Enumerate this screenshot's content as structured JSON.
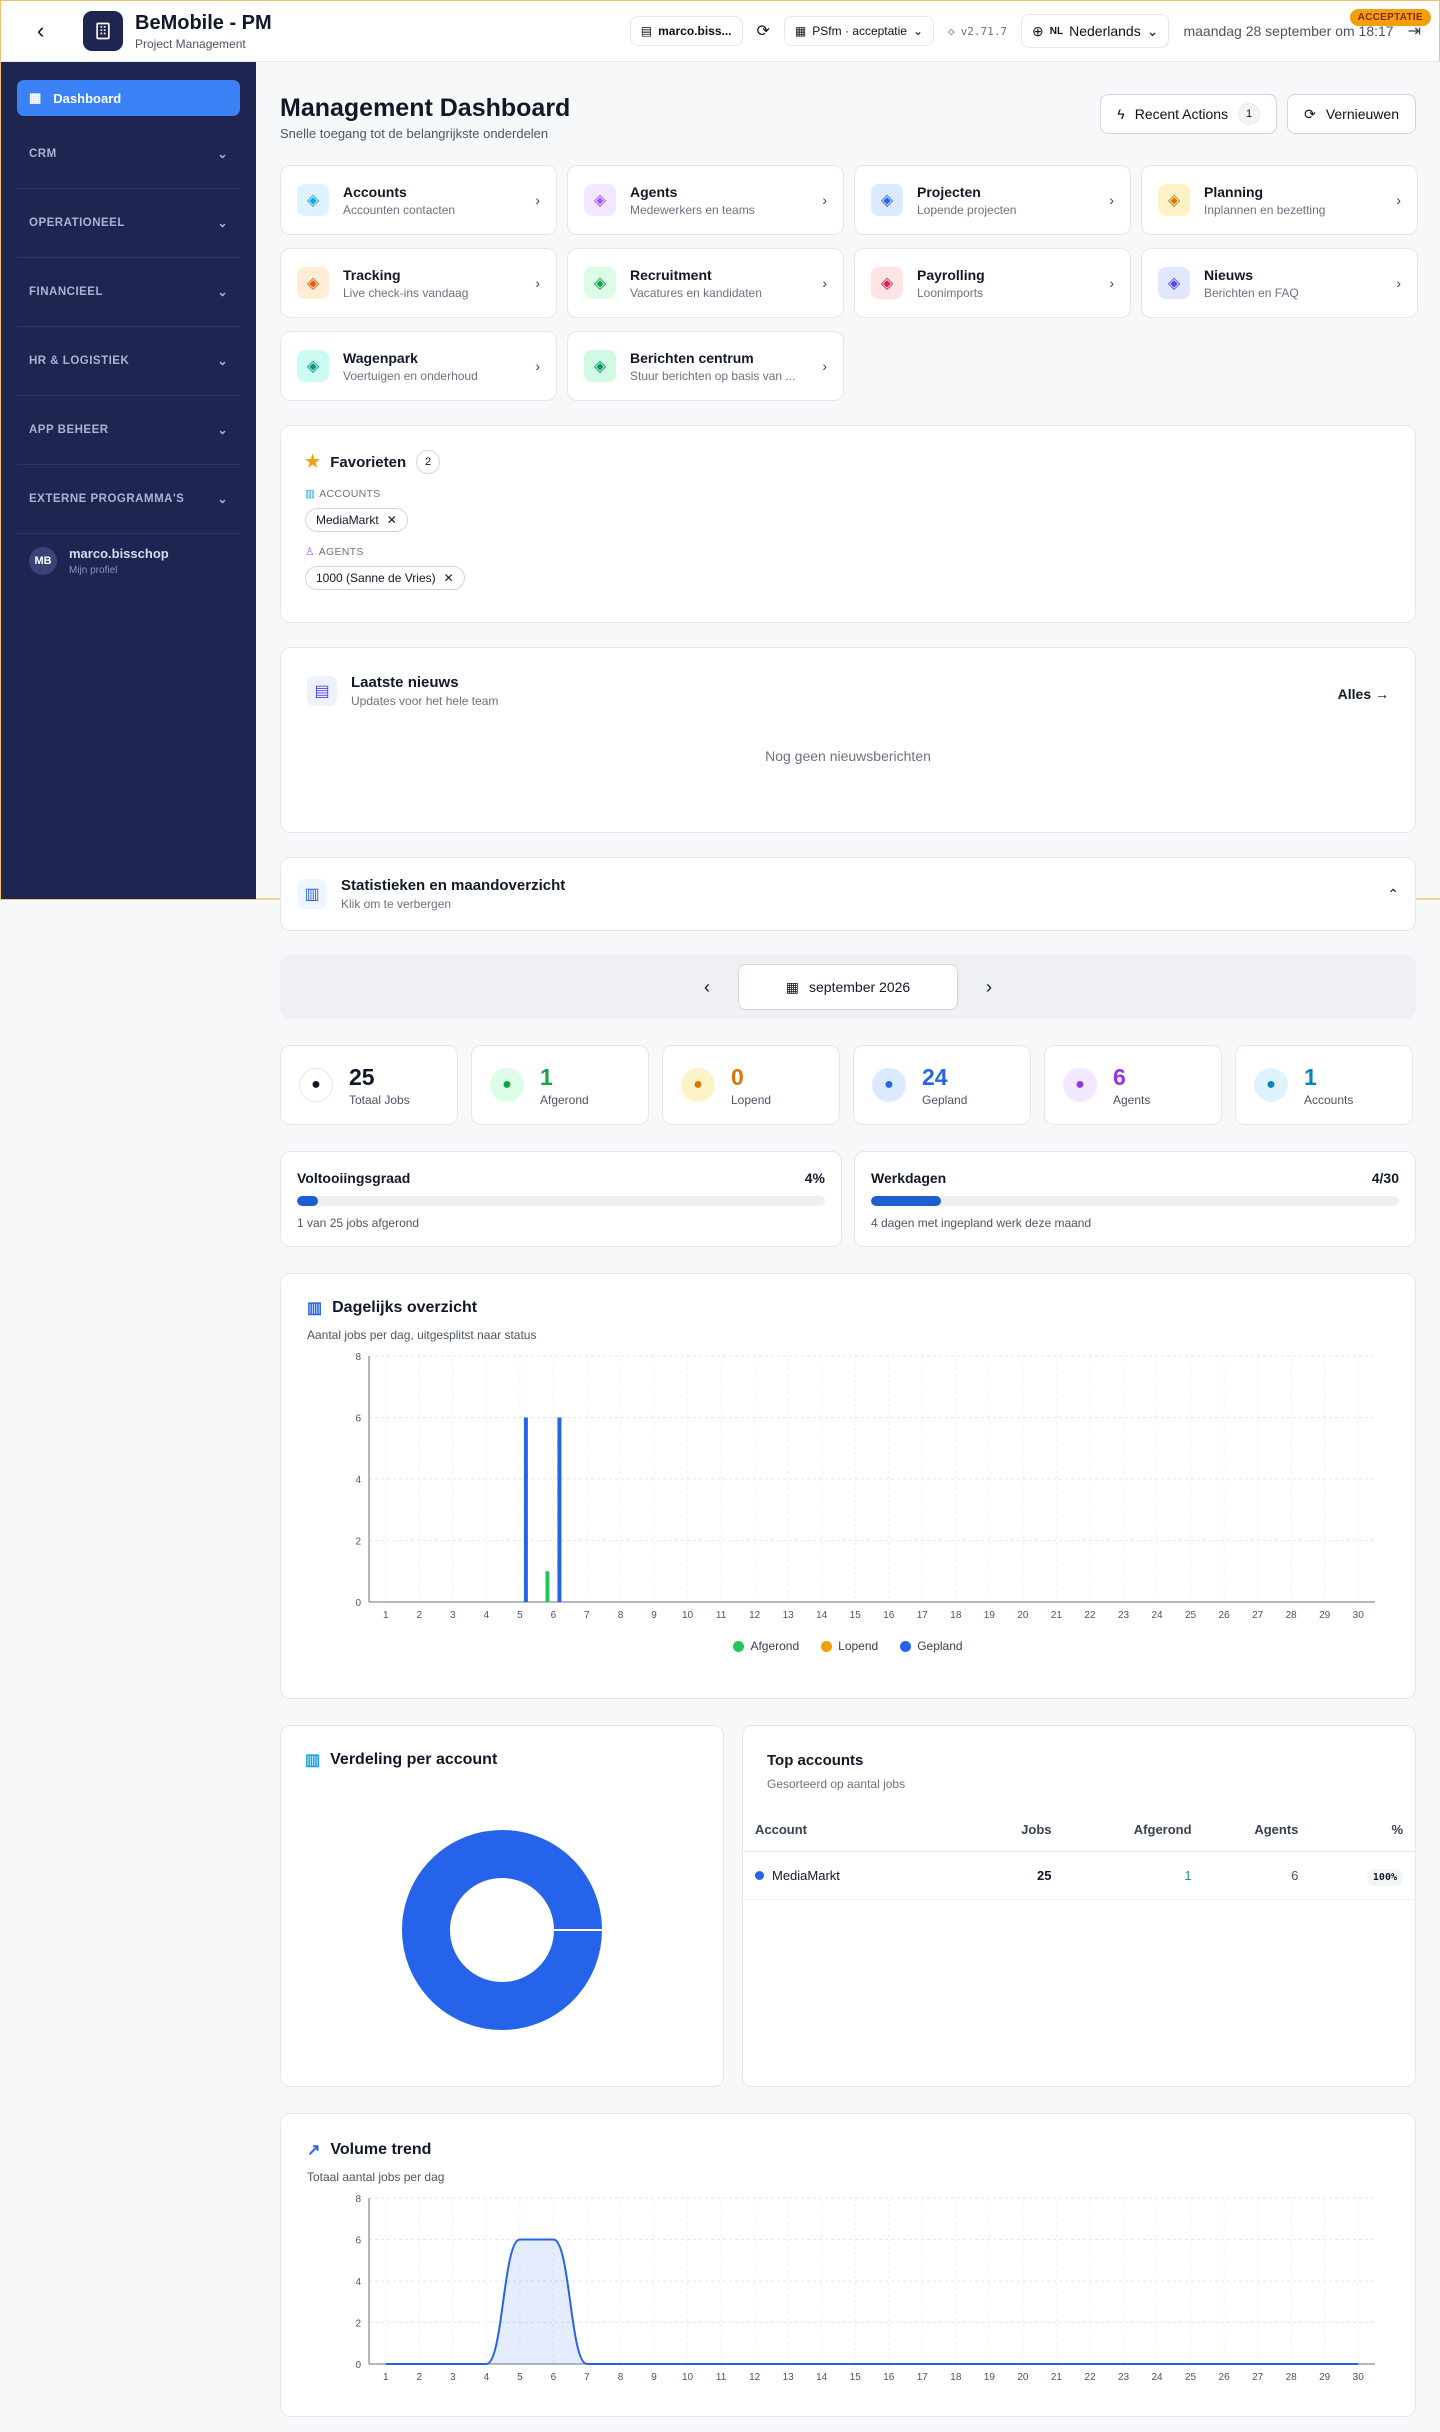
{
  "header": {
    "back": "‹",
    "title": "BeMobile - PM",
    "subtitle": "Project Management",
    "server": "marco.biss...",
    "environment": "PSfm · acceptatie",
    "version": "v2.71.7",
    "language_code": "NL",
    "language": "Nederlands",
    "datetime": "maandag 28 september om 18:17",
    "env_badge": "ACCEPTATIE"
  },
  "sidebar": {
    "dashboard": "Dashboard",
    "sections": [
      "CRM",
      "OPERATIONEEL",
      "FINANCIEEL",
      "HR & LOGISTIEK",
      "APP BEHEER",
      "EXTERNE PROGRAMMA'S"
    ],
    "profile": {
      "initials": "MB",
      "name": "marco.bisschop",
      "sub": "Mijn profiel"
    }
  },
  "page": {
    "title": "Management Dashboard",
    "subtitle": "Snelle toegang tot de belangrijkste onderdelen",
    "recent_actions": "Recent Actions",
    "recent_count": "1",
    "refresh": "Vernieuwen"
  },
  "tiles": [
    {
      "title": "Accounts",
      "sub": "Accounten contacten",
      "color": "#0ea5e9",
      "bg": "#e0f2fe",
      "icon": "building-icon"
    },
    {
      "title": "Agents",
      "sub": "Medewerkers en teams",
      "color": "#a855f7",
      "bg": "#f3e8ff",
      "icon": "users-icon"
    },
    {
      "title": "Projecten",
      "sub": "Lopende projecten",
      "color": "#2563eb",
      "bg": "#dbeafe",
      "icon": "folder-icon"
    },
    {
      "title": "Planning",
      "sub": "Inplannen en bezetting",
      "color": "#d97706",
      "bg": "#fef3c7",
      "icon": "calendar-icon"
    },
    {
      "title": "Tracking",
      "sub": "Live check-ins vandaag",
      "color": "#ea580c",
      "bg": "#ffedd5",
      "icon": "eye-icon"
    },
    {
      "title": "Recruitment",
      "sub": "Vacatures en kandidaten",
      "color": "#16a34a",
      "bg": "#dcfce7",
      "icon": "user-plus-icon"
    },
    {
      "title": "Payrolling",
      "sub": "Loonimports",
      "color": "#e11d48",
      "bg": "#ffe4e6",
      "icon": "document-icon"
    },
    {
      "title": "Nieuws",
      "sub": "Berichten en FAQ",
      "color": "#4f46e5",
      "bg": "#e0e7ff",
      "icon": "megaphone-icon"
    },
    {
      "title": "Wagenpark",
      "sub": "Voertuigen en onderhoud",
      "color": "#0d9488",
      "bg": "#ccfbf1",
      "icon": "car-icon"
    },
    {
      "title": "Berichten centrum",
      "sub": "Stuur berichten op basis van ...",
      "color": "#059669",
      "bg": "#d1fae5",
      "icon": "message-icon"
    }
  ],
  "favorites": {
    "title": "Favorieten",
    "count": "2",
    "groups": [
      {
        "label": "ACCOUNTS",
        "items": [
          "MediaMarkt"
        ]
      },
      {
        "label": "AGENTS",
        "items": [
          "1000 (Sanne de Vries)"
        ]
      }
    ]
  },
  "news": {
    "title": "Laatste nieuws",
    "sub": "Updates voor het hele team",
    "all": "Alles →",
    "empty": "Nog geen nieuwsberichten"
  },
  "stats": {
    "title": "Statistieken en maandoverzicht",
    "sub": "Klik om te verbergen",
    "month": "september 2026"
  },
  "kpis": [
    {
      "value": "25",
      "label": "Totaal Jobs",
      "color": "#111827",
      "bg": "#fff",
      "icon": "briefcase-icon"
    },
    {
      "value": "1",
      "label": "Afgerond",
      "color": "#16a34a",
      "bg": "#dcfce7",
      "icon": "check-circle-icon"
    },
    {
      "value": "0",
      "label": "Lopend",
      "color": "#d97706",
      "bg": "#fef3c7",
      "icon": "clock-icon"
    },
    {
      "value": "24",
      "label": "Gepland",
      "color": "#2563eb",
      "bg": "#dbeafe",
      "icon": "calendar-icon"
    },
    {
      "value": "6",
      "label": "Agents",
      "color": "#9333ea",
      "bg": "#f3e8ff",
      "icon": "users-icon"
    },
    {
      "value": "1",
      "label": "Accounts",
      "color": "#0284c7",
      "bg": "#e0f2fe",
      "icon": "building-icon"
    }
  ],
  "progress": [
    {
      "label": "Voltooiingsgraad",
      "value": "4%",
      "fraction": 0.04,
      "note": "1 van 25 jobs afgerond"
    },
    {
      "label": "Werkdagen",
      "value": "4/30",
      "fraction": 0.1333,
      "note": "4 dagen met ingepland werk deze maand"
    }
  ],
  "daily": {
    "title": "Dagelijks overzicht",
    "sub": "Aantal jobs per dag, uitgesplitst naar status"
  },
  "pie_card": {
    "title": "Verdeling per account"
  },
  "top_accounts": {
    "title": "Top accounts",
    "sub": "Gesorteerd op aantal jobs",
    "headers": [
      "Account",
      "Jobs",
      "Afgerond",
      "Agents",
      "%"
    ],
    "rows": [
      {
        "account": "MediaMarkt",
        "jobs": "25",
        "done": "1",
        "agents": "6",
        "pct": "100%"
      }
    ]
  },
  "volume": {
    "title": "Volume trend",
    "sub": "Totaal aantal jobs per dag"
  },
  "chart_data": [
    {
      "type": "bar",
      "x": [
        1,
        2,
        3,
        4,
        5,
        6,
        7,
        8,
        9,
        10,
        11,
        12,
        13,
        14,
        15,
        16,
        17,
        18,
        19,
        20,
        21,
        22,
        23,
        24,
        25,
        26,
        27,
        28,
        29,
        30
      ],
      "ylim": [
        0,
        8
      ],
      "yticks": [
        0,
        2,
        4,
        6,
        8
      ],
      "series": [
        {
          "name": "Afgerond",
          "color": "#22c55e",
          "values": [
            0,
            0,
            0,
            0,
            0,
            1,
            0,
            0,
            0,
            0,
            0,
            0,
            0,
            0,
            0,
            0,
            0,
            0,
            0,
            0,
            0,
            0,
            0,
            0,
            0,
            0,
            0,
            0,
            0,
            0
          ]
        },
        {
          "name": "Lopend",
          "color": "#f59e0b",
          "values": [
            0,
            0,
            0,
            0,
            0,
            0,
            0,
            0,
            0,
            0,
            0,
            0,
            0,
            0,
            0,
            0,
            0,
            0,
            0,
            0,
            0,
            0,
            0,
            0,
            0,
            0,
            0,
            0,
            0,
            0
          ]
        },
        {
          "name": "Gepland",
          "color": "#2563eb",
          "values": [
            0,
            0,
            0,
            0,
            6,
            6,
            0,
            0,
            0,
            0,
            0,
            0,
            0,
            0,
            0,
            0,
            0,
            0,
            0,
            0,
            0,
            0,
            0,
            0,
            0,
            0,
            0,
            0,
            0,
            0
          ]
        }
      ]
    },
    {
      "type": "pie",
      "labels": [
        "MediaMarkt"
      ],
      "values": [
        25
      ],
      "colors": [
        "#2563eb"
      ]
    },
    {
      "type": "area",
      "x": [
        1,
        2,
        3,
        4,
        5,
        6,
        7,
        8,
        9,
        10,
        11,
        12,
        13,
        14,
        15,
        16,
        17,
        18,
        19,
        20,
        21,
        22,
        23,
        24,
        25,
        26,
        27,
        28,
        29,
        30
      ],
      "ylim": [
        0,
        8
      ],
      "yticks": [
        0,
        2,
        4,
        6,
        8
      ],
      "series": [
        {
          "name": "Totaal",
          "color": "#2563eb",
          "values": [
            0,
            0,
            0,
            0,
            6,
            6,
            0,
            0,
            0,
            0,
            0,
            0,
            0,
            0,
            0,
            0,
            0,
            0,
            0,
            0,
            0,
            0,
            0,
            0,
            0,
            0,
            0,
            0,
            0,
            0
          ]
        }
      ]
    }
  ]
}
